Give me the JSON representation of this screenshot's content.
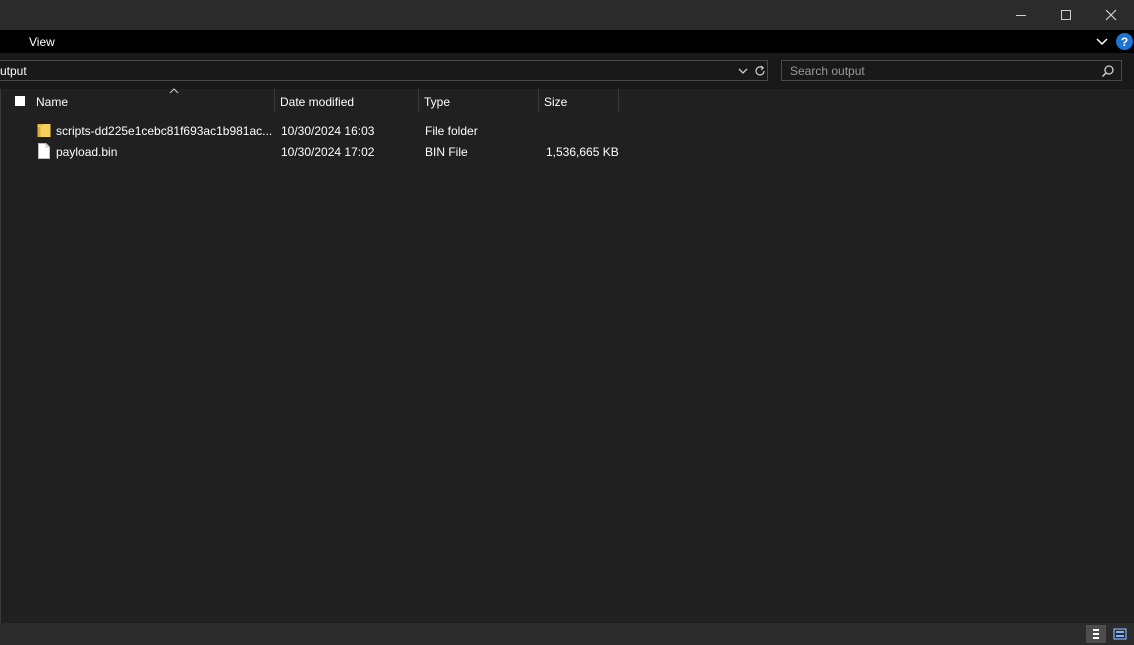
{
  "window": {
    "controls": {
      "minimize_icon": "minimize-icon",
      "maximize_icon": "maximize-icon",
      "close_icon": "close-icon"
    }
  },
  "ribbon": {
    "tabs": [
      {
        "label": "View"
      }
    ],
    "help_label": "?"
  },
  "address_bar": {
    "path_text": "utput"
  },
  "search": {
    "placeholder": "Search output"
  },
  "columns": [
    {
      "label": "Name"
    },
    {
      "label": "Date modified"
    },
    {
      "label": "Type"
    },
    {
      "label": "Size"
    }
  ],
  "files": [
    {
      "name": "scripts-dd225e1cebc81f693ac1b981ac...",
      "date_modified": "10/30/2024 16:03",
      "type": "File folder",
      "size": "",
      "icon": "folder-icon"
    },
    {
      "name": "payload.bin",
      "date_modified": "10/30/2024 17:02",
      "type": "BIN File",
      "size": "1,536,665 KB",
      "icon": "file-icon"
    }
  ],
  "colors": {
    "background": "#202020",
    "titlebar": "#2b2b2b",
    "ribbon": "#000000",
    "folder": "#f4d25b",
    "help_accent": "#1e73d6"
  }
}
